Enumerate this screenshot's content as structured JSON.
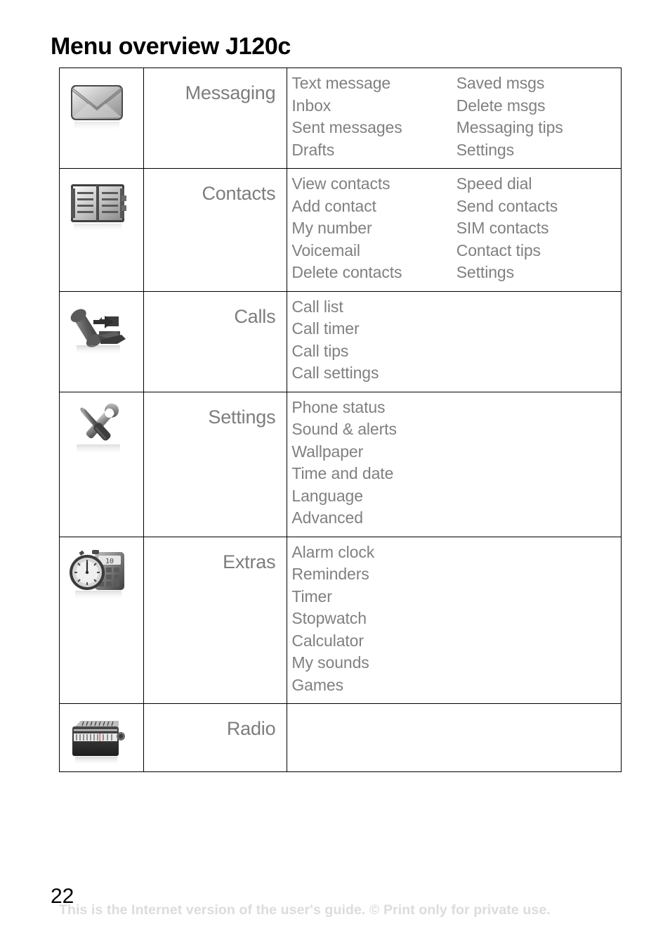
{
  "header": {
    "title": "Menu overview J120c"
  },
  "menu": {
    "rows": [
      {
        "icon": "envelope-icon",
        "label": "Messaging",
        "column1": [
          "Text message",
          "Inbox",
          "Sent messages",
          "Drafts"
        ],
        "column2": [
          "Saved msgs",
          "Delete msgs",
          "Messaging tips",
          "Settings"
        ]
      },
      {
        "icon": "address-book-icon",
        "label": "Contacts",
        "column1": [
          "View contacts",
          "Add contact",
          "My number",
          "Voicemail",
          "Delete contacts"
        ],
        "column2": [
          "Speed dial",
          "Send contacts",
          "SIM contacts",
          "Contact tips",
          "Settings"
        ]
      },
      {
        "icon": "phone-handset-icon",
        "label": "Calls",
        "column1": [
          "Call list",
          "Call timer",
          "Call tips",
          "Call settings"
        ],
        "column2": []
      },
      {
        "icon": "tools-icon",
        "label": "Settings",
        "column1": [
          "Phone status",
          "Sound & alerts",
          "Wallpaper",
          "Time and date",
          "Language",
          "Advanced"
        ],
        "column2": []
      },
      {
        "icon": "stopwatch-calculator-icon",
        "label": "Extras",
        "column1": [
          "Alarm clock",
          "Reminders",
          "Timer",
          "Stopwatch",
          "Calculator",
          "My sounds",
          "Games"
        ],
        "column2": []
      },
      {
        "icon": "radio-icon",
        "label": "Radio",
        "column1": [],
        "column2": []
      }
    ]
  },
  "footer": {
    "page_number": "22",
    "note": "This is the Internet version of the user's guide. © Print only for private use."
  },
  "colors": {
    "text_gray": "#808080",
    "label_gray": "#7d7d7d",
    "border": "#000000",
    "watermark": "#dcdcdc"
  }
}
